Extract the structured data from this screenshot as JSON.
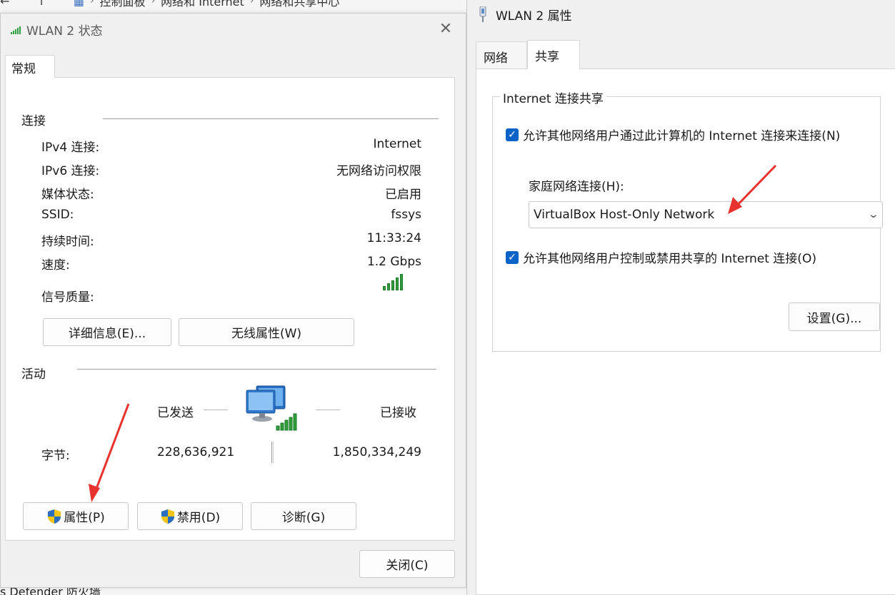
{
  "background": {
    "breadcrumb": [
      "控制面板",
      "网络和 Internet",
      "网络和共享中心"
    ],
    "footer_text": "s Defender 防火墙"
  },
  "status_dialog": {
    "title": "WLAN 2 状态",
    "tab": "常规",
    "connection_group": "连接",
    "rows": [
      {
        "label": "IPv4 连接:",
        "value": "Internet"
      },
      {
        "label": "IPv6 连接:",
        "value": "无网络访问权限"
      },
      {
        "label": "媒体状态:",
        "value": "已启用"
      },
      {
        "label": "SSID:",
        "value": "fssys"
      },
      {
        "label": "持续时间:",
        "value": "11:33:24"
      },
      {
        "label": "速度:",
        "value": "1.2 Gbps"
      }
    ],
    "signal_label": "信号质量:",
    "signal_level": "5/5",
    "details_button": "详细信息(E)...",
    "wireless_button": "无线属性(W)",
    "activity_group": "活动",
    "sent_label": "已发送",
    "received_label": "已接收",
    "bytes_label": "字节:",
    "bytes_sent": "228,636,921",
    "bytes_received": "1,850,334,249",
    "properties_button": "属性(P)",
    "disable_button": "禁用(D)",
    "diagnose_button": "诊断(G)",
    "close_button": "关闭(C)"
  },
  "properties_dialog": {
    "title": "WLAN 2 属性",
    "tabs": [
      "网络",
      "共享"
    ],
    "active_tab": "共享",
    "group_title": "Internet 连接共享",
    "allow_connect_label": "允许其他网络用户通过此计算机的 Internet 连接来连接(N)",
    "allow_connect_checked": true,
    "home_network_label": "家庭网络连接(H):",
    "home_network_value": "VirtualBox Host-Only Network",
    "allow_control_label": "允许其他网络用户控制或禁用共享的 Internet 连接(O)",
    "allow_control_checked": true,
    "settings_button": "设置(G)..."
  },
  "colors": {
    "annotation_arrow": "#e8322d",
    "checkbox": "#0a64c8",
    "signal": "#2f9e3a"
  }
}
